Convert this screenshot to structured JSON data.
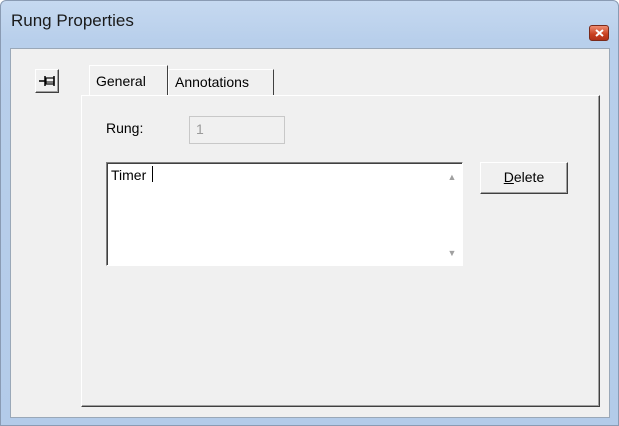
{
  "window": {
    "title": "Rung Properties"
  },
  "tabs": [
    {
      "label": "General",
      "active": true
    },
    {
      "label": "Annotations",
      "active": false
    }
  ],
  "general": {
    "rung_label": "Rung:",
    "rung_value": "1",
    "annotation_text": "Timer",
    "delete_accelerator": "D",
    "delete_rest": "elete"
  },
  "icons": {
    "close": "close-icon",
    "pin": "pin-icon",
    "scroll_up": "scroll-up-icon",
    "scroll_down": "scroll-down-icon"
  },
  "colors": {
    "close_button": "#c8401f",
    "titlebar": "#c6d9f0",
    "dialog_face": "#f0f0f0"
  }
}
